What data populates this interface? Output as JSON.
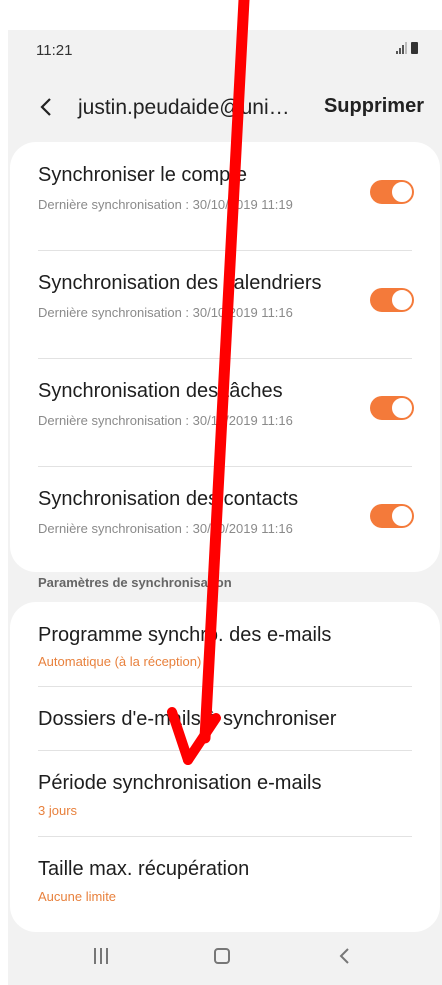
{
  "status_bar": {
    "time": "11:21",
    "icons": [
      "signal-icon",
      "battery-icon"
    ]
  },
  "header": {
    "back_icon": "chevron-left-icon",
    "account": "justin.peudaide@uni…",
    "delete_label": "Supprimer"
  },
  "sync_items": [
    {
      "title": "Synchroniser le compte",
      "subtitle": "Dernière synchronisation : 30/10/2019 11:19",
      "enabled": true
    },
    {
      "title": "Synchronisation des calendriers",
      "subtitle": "Dernière synchronisation : 30/10/2019 11:16",
      "enabled": true
    },
    {
      "title": "Synchronisation des tâches",
      "subtitle": "Dernière synchronisation : 30/10/2019 11:16",
      "enabled": true
    },
    {
      "title": "Synchronisation des contacts",
      "subtitle": "Dernière synchronisation : 30/10/2019 11:16",
      "enabled": true
    }
  ],
  "section_header": "Paramètres de synchronisation",
  "settings_items": [
    {
      "title": "Programme synchro. des e-mails",
      "value": "Automatique (à la réception)"
    },
    {
      "title": "Dossiers d'e-mails à synchroniser",
      "value": ""
    },
    {
      "title": "Période synchronisation e-mails",
      "value": "3 jours"
    },
    {
      "title": "Taille max. récupération",
      "value": "Aucune limite"
    }
  ],
  "nav_bar": {
    "icons": [
      "recents-icon",
      "home-icon",
      "back-icon"
    ]
  },
  "colors": {
    "accent": "#f47a3a",
    "value_text": "#e8813d",
    "annotation_arrow": "#ff0000"
  },
  "annotation": {
    "icon": "arrow-down-icon"
  }
}
